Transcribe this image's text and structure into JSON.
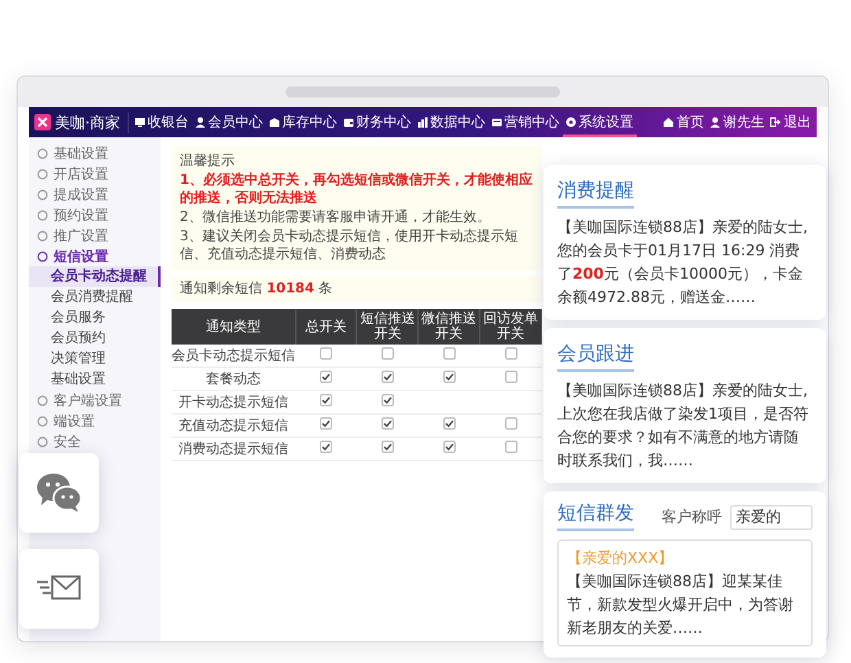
{
  "app": {
    "logo": "美咖·商家",
    "nav": [
      {
        "label": "收银台",
        "selected": false
      },
      {
        "label": "会员中心",
        "selected": false
      },
      {
        "label": "库存中心",
        "selected": false
      },
      {
        "label": "财务中心",
        "selected": false
      },
      {
        "label": "数据中心",
        "selected": false
      },
      {
        "label": "营销中心",
        "selected": false
      },
      {
        "label": "系统设置",
        "selected": true
      }
    ],
    "user_menu": [
      "首页",
      "谢先生",
      "退出"
    ],
    "sidebar": {
      "items": [
        {
          "label": "基础设置",
          "expanded": false
        },
        {
          "label": "开店设置",
          "expanded": false
        },
        {
          "label": "提成设置",
          "expanded": false
        },
        {
          "label": "预约设置",
          "expanded": false
        },
        {
          "label": "推广设置",
          "expanded": false
        },
        {
          "label": "短信设置",
          "expanded": true,
          "children": [
            {
              "label": "会员卡动态提醒",
              "selected": true
            },
            {
              "label": "会员消费提醒",
              "selected": false
            },
            {
              "label": "会员服务",
              "selected": false
            },
            {
              "label": "会员预约",
              "selected": false
            },
            {
              "label": "决策管理",
              "selected": false
            },
            {
              "label": "基础设置",
              "selected": false
            }
          ]
        },
        {
          "label": "客户端设置",
          "expanded": false
        },
        {
          "label": "端设置",
          "expanded": false
        },
        {
          "label": "安全",
          "expanded": false
        }
      ]
    },
    "tips": {
      "title": "温馨提示",
      "lines": [
        {
          "text": "1、必须选中总开关，再勾选短信或微信开关，才能使相应的推送，否则无法推送",
          "emphasis": true
        },
        {
          "text": "2、微信推送功能需要请客服申请开通，才能生效。",
          "emphasis": false
        },
        {
          "text": "3、建议关闭会员卡动态提示短信，使用开卡动态提示短信、充值动态提示短信、消费动态",
          "emphasis": false
        }
      ]
    },
    "balance": {
      "label": "通知剩余短信",
      "count": "10184",
      "unit": "条"
    },
    "table": {
      "columns": [
        "通知类型",
        "总开关",
        "短信推送开关",
        "微信推送开关",
        "回访发单开关"
      ],
      "rows": [
        {
          "type": "会员卡动态提示短信",
          "cells": [
            {
              "kind": "checkbox",
              "checked": false
            },
            {
              "kind": "checkbox",
              "checked": false
            },
            {
              "kind": "checkbox",
              "checked": false
            },
            {
              "kind": "checkbox",
              "checked": false
            }
          ]
        },
        {
          "type": "套餐动态",
          "cells": [
            {
              "kind": "checkbox",
              "checked": true
            },
            {
              "kind": "checkbox",
              "checked": true
            },
            {
              "kind": "checkbox",
              "checked": true
            },
            {
              "kind": "checkbox",
              "checked": false
            }
          ]
        },
        {
          "type": "开卡动态提示短信",
          "cells": [
            {
              "kind": "checkbox",
              "checked": true
            },
            {
              "kind": "checkbox",
              "checked": true
            },
            {
              "kind": "blank"
            },
            {
              "kind": "blank"
            }
          ]
        },
        {
          "type": "充值动态提示短信",
          "cells": [
            {
              "kind": "checkbox",
              "checked": true
            },
            {
              "kind": "checkbox",
              "checked": true
            },
            {
              "kind": "checkbox",
              "checked": true
            },
            {
              "kind": "checkbox",
              "checked": false
            }
          ]
        },
        {
          "type": "消费动态提示短信",
          "cells": [
            {
              "kind": "checkbox",
              "checked": true
            },
            {
              "kind": "checkbox",
              "checked": true
            },
            {
              "kind": "checkbox",
              "checked": true
            },
            {
              "kind": "checkbox",
              "checked": false
            }
          ]
        }
      ]
    }
  },
  "cards": [
    {
      "title": "消费提醒",
      "message": [
        {
          "text": "【美咖国际连锁88店】亲爱的陆女士,您的会员卡于01月17日 16:29 消费了",
          "highlight": false
        },
        {
          "text": "200",
          "highlight": true
        },
        {
          "text": "元（会员卡10000元），卡金余额4972.88元，赠送金……",
          "highlight": false
        }
      ]
    },
    {
      "title": "会员跟进",
      "message": [
        {
          "text": "【美咖国际连锁88店】亲爱的陆女士,上次您在我店做了染发1项目，是否符合您的要求？如有不满意的地方请随时联系我们，我……",
          "highlight": false
        }
      ]
    }
  ],
  "broadcast": {
    "title": "短信群发",
    "field_label": "客户称呼",
    "field_value": "亲爱的",
    "greeting": "【亲爱的XXX】",
    "message": "【美咖国际连锁88店】迎某某佳节，新款发型火爆开启中，为答谢新老朋友的关爱……"
  }
}
